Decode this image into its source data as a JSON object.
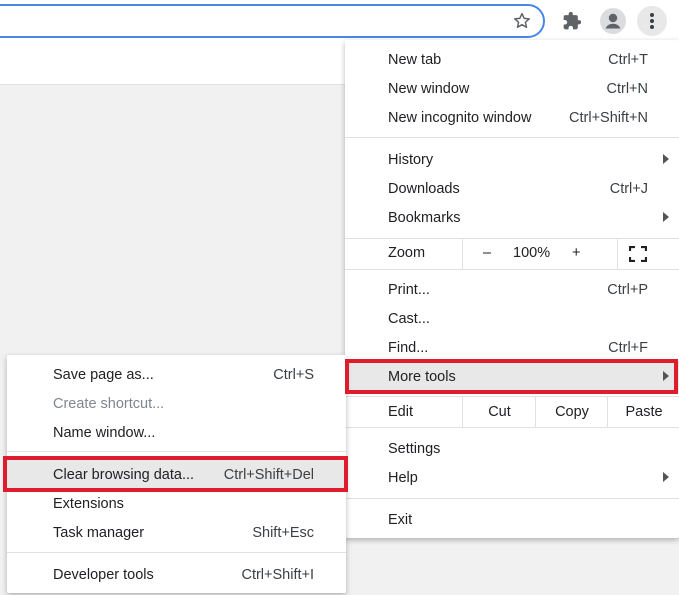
{
  "toolbar": {
    "bookmark_icon": "star-icon",
    "extensions_icon": "puzzle-icon",
    "profile_icon": "person-icon",
    "menu_icon": "kebab-icon"
  },
  "main_menu": {
    "group1": [
      {
        "label": "New tab",
        "shortcut": "Ctrl+T"
      },
      {
        "label": "New window",
        "shortcut": "Ctrl+N"
      },
      {
        "label": "New incognito window",
        "shortcut": "Ctrl+Shift+N"
      }
    ],
    "group2": [
      {
        "label": "History",
        "shortcut": ""
      },
      {
        "label": "Downloads",
        "shortcut": "Ctrl+J"
      },
      {
        "label": "Bookmarks",
        "shortcut": ""
      }
    ],
    "zoom": {
      "label": "Zoom",
      "minus": "–",
      "value": "100%",
      "plus": "+"
    },
    "group3": [
      {
        "label": "Print...",
        "shortcut": "Ctrl+P"
      },
      {
        "label": "Cast...",
        "shortcut": ""
      },
      {
        "label": "Find...",
        "shortcut": "Ctrl+F"
      },
      {
        "label": "More tools",
        "shortcut": ""
      }
    ],
    "edit": {
      "label": "Edit",
      "cut": "Cut",
      "copy": "Copy",
      "paste": "Paste"
    },
    "group4": [
      {
        "label": "Settings",
        "shortcut": ""
      },
      {
        "label": "Help",
        "shortcut": ""
      }
    ],
    "exit": {
      "label": "Exit"
    }
  },
  "sub_menu": {
    "group1": [
      {
        "label": "Save page as...",
        "shortcut": "Ctrl+S"
      },
      {
        "label": "Create shortcut...",
        "shortcut": ""
      },
      {
        "label": "Name window...",
        "shortcut": ""
      }
    ],
    "group2": [
      {
        "label": "Clear browsing data...",
        "shortcut": "Ctrl+Shift+Del"
      },
      {
        "label": "Extensions",
        "shortcut": ""
      },
      {
        "label": "Task manager",
        "shortcut": "Shift+Esc"
      }
    ],
    "group3": [
      {
        "label": "Developer tools",
        "shortcut": "Ctrl+Shift+I"
      }
    ]
  },
  "colors": {
    "highlight_frame": "#dd1d2b",
    "omnibox_focus": "#4a86e8"
  }
}
